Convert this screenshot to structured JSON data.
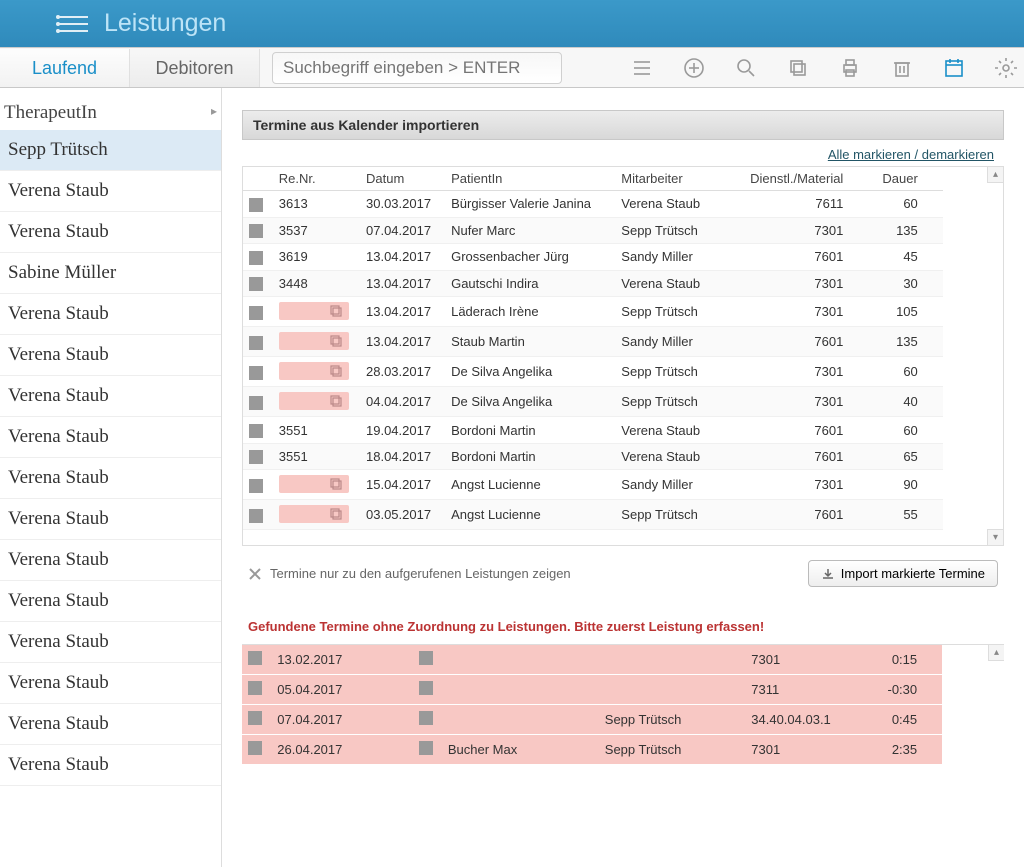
{
  "header": {
    "title": "Leistungen"
  },
  "tabs": {
    "laufend": "Laufend",
    "debitoren": "Debitoren"
  },
  "search": {
    "placeholder": "Suchbegriff eingeben > ENTER"
  },
  "sidebar": {
    "heading": "TherapeutIn",
    "items": [
      {
        "name": "Sepp Trütsch",
        "selected": true
      },
      {
        "name": "Verena Staub"
      },
      {
        "name": "Verena Staub"
      },
      {
        "name": "Sabine Müller"
      },
      {
        "name": "Verena Staub"
      },
      {
        "name": "Verena Staub"
      },
      {
        "name": "Verena Staub"
      },
      {
        "name": "Verena Staub"
      },
      {
        "name": "Verena Staub"
      },
      {
        "name": "Verena Staub"
      },
      {
        "name": "Verena Staub"
      },
      {
        "name": "Verena Staub"
      },
      {
        "name": "Verena Staub"
      },
      {
        "name": "Verena Staub"
      },
      {
        "name": "Verena Staub"
      },
      {
        "name": "Verena Staub"
      }
    ]
  },
  "panel": {
    "title": "Termine aus Kalender importieren",
    "toggle_all": "Alle markieren / demarkieren",
    "columns": {
      "renr": "Re.Nr.",
      "datum": "Datum",
      "patient": "PatientIn",
      "mitarbeiter": "Mitarbeiter",
      "dienst": "Dienstl./Material",
      "dauer": "Dauer"
    },
    "rows": [
      {
        "renr": "3613",
        "datum": "30.03.2017",
        "patient": "Bürgisser Valerie Janina",
        "mitarbeiter": "Verena Staub",
        "dienst": "7611",
        "dauer": "60"
      },
      {
        "renr": "3537",
        "datum": "07.04.2017",
        "patient": "Nufer Marc",
        "mitarbeiter": "Sepp Trütsch",
        "dienst": "7301",
        "dauer": "135"
      },
      {
        "renr": "3619",
        "datum": "13.04.2017",
        "patient": "Grossenbacher Jürg",
        "mitarbeiter": "Sandy Miller",
        "dienst": "7601",
        "dauer": "45"
      },
      {
        "renr": "3448",
        "datum": "13.04.2017",
        "patient": "Gautschi Indira",
        "mitarbeiter": "Verena Staub",
        "dienst": "7301",
        "dauer": "30"
      },
      {
        "pink": true,
        "datum": "13.04.2017",
        "patient": "Läderach Irène",
        "mitarbeiter": "Sepp Trütsch",
        "dienst": "7301",
        "dauer": "105"
      },
      {
        "pink": true,
        "datum": "13.04.2017",
        "patient": "Staub Martin",
        "mitarbeiter": "Sandy Miller",
        "dienst": "7601",
        "dauer": "135"
      },
      {
        "pink": true,
        "datum": "28.03.2017",
        "patient": "De Silva Angelika",
        "mitarbeiter": "Sepp Trütsch",
        "dienst": "7301",
        "dauer": "60"
      },
      {
        "pink": true,
        "datum": "04.04.2017",
        "patient": "De Silva Angelika",
        "mitarbeiter": "Sepp Trütsch",
        "dienst": "7301",
        "dauer": "40"
      },
      {
        "renr": "3551",
        "datum": "19.04.2017",
        "patient": "Bordoni Martin",
        "mitarbeiter": "Verena Staub",
        "dienst": "7601",
        "dauer": "60"
      },
      {
        "renr": "3551",
        "datum": "18.04.2017",
        "patient": "Bordoni Martin",
        "mitarbeiter": "Verena Staub",
        "dienst": "7601",
        "dauer": "65"
      },
      {
        "pink": true,
        "datum": "15.04.2017",
        "patient": "Angst Lucienne",
        "mitarbeiter": "Sandy Miller",
        "dienst": "7301",
        "dauer": "90"
      },
      {
        "pink": true,
        "datum": "03.05.2017",
        "patient": "Angst Lucienne",
        "mitarbeiter": "Sepp Trütsch",
        "dienst": "7601",
        "dauer": "55"
      }
    ],
    "filter_label": "Termine nur zu den aufgerufenen Leistungen zeigen",
    "import_button": "Import markierte Termine",
    "warning": "Gefundene Termine ohne Zuordnung zu Leistungen. Bitte zuerst Leistung erfassen!",
    "unassigned_rows": [
      {
        "datum": "13.02.2017",
        "patient": "",
        "mitarbeiter": "",
        "dienst": "7301",
        "dauer": "0:15"
      },
      {
        "datum": "05.04.2017",
        "patient": "",
        "mitarbeiter": "",
        "dienst": "7311",
        "dauer": "-0:30"
      },
      {
        "datum": "07.04.2017",
        "patient": "",
        "mitarbeiter": "Sepp Trütsch",
        "dienst": "34.40.04.03.1",
        "dauer": "0:45"
      },
      {
        "datum": "26.04.2017",
        "patient": "Bucher Max",
        "mitarbeiter": "Sepp Trütsch",
        "dienst": "7301",
        "dauer": "2:35"
      }
    ]
  }
}
